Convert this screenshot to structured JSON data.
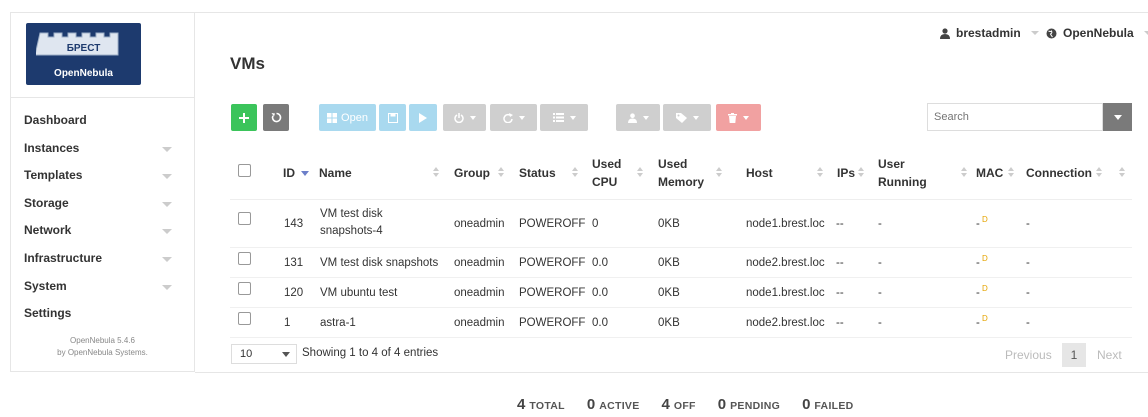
{
  "brand": {
    "logo_text": "БРЕСТ",
    "product": "OpenNebula",
    "colors": {
      "logo_bg": "#1d3a6e"
    }
  },
  "sidebar": {
    "items": [
      {
        "label": "Dashboard",
        "has_submenu": false
      },
      {
        "label": "Instances",
        "has_submenu": true
      },
      {
        "label": "Templates",
        "has_submenu": true
      },
      {
        "label": "Storage",
        "has_submenu": true
      },
      {
        "label": "Network",
        "has_submenu": true
      },
      {
        "label": "Infrastructure",
        "has_submenu": true
      },
      {
        "label": "System",
        "has_submenu": true
      },
      {
        "label": "Settings",
        "has_submenu": false
      }
    ],
    "version_line1": "OpenNebula 5.4.6",
    "version_line2": "by OpenNebula Systems."
  },
  "header": {
    "user": "brestadmin",
    "zone": "OpenNebula",
    "user_icon": "user-icon",
    "zone_icon": "globe-icon"
  },
  "page": {
    "title": "VMs"
  },
  "toolbar": {
    "create_icon": "plus-icon",
    "refresh_icon": "refresh-icon",
    "open_label": "Open",
    "search_placeholder": "Search",
    "colors": {
      "create": "#3bc45b",
      "refresh": "#7a7a7a",
      "search_button": "#7a7a7a"
    }
  },
  "table": {
    "columns": [
      "ID",
      "Name",
      "Group",
      "Status",
      "Used CPU",
      "Used Memory",
      "Host",
      "IPs",
      "User Running",
      "MAC",
      "Connection"
    ],
    "rows": [
      {
        "id": "143",
        "name": "VM test disk snapshots-4",
        "group": "oneadmin",
        "status": "POWEROFF",
        "cpu": "0",
        "memory": "0KB",
        "host": "node1.brest.loc",
        "ips": "--",
        "user_running": "-",
        "mac": "-",
        "mac_sup": "D",
        "connection": "-"
      },
      {
        "id": "131",
        "name": "VM test disk snapshots",
        "group": "oneadmin",
        "status": "POWEROFF",
        "cpu": "0.0",
        "memory": "0KB",
        "host": "node2.brest.loc",
        "ips": "--",
        "user_running": "-",
        "mac": "-",
        "mac_sup": "D",
        "connection": "-"
      },
      {
        "id": "120",
        "name": "VM ubuntu test",
        "group": "oneadmin",
        "status": "POWEROFF",
        "cpu": "0.0",
        "memory": "0KB",
        "host": "node1.brest.loc",
        "ips": "--",
        "user_running": "-",
        "mac": "-",
        "mac_sup": "D",
        "connection": "-"
      },
      {
        "id": "1",
        "name": "astra-1",
        "group": "oneadmin",
        "status": "POWEROFF",
        "cpu": "0.0",
        "memory": "0KB",
        "host": "node2.brest.loc",
        "ips": "--",
        "user_running": "-",
        "mac": "-",
        "mac_sup": "D",
        "connection": "-"
      }
    ]
  },
  "pagination": {
    "length": "10",
    "info": "Showing 1 to 4 of 4 entries",
    "previous": "Previous",
    "current": "1",
    "next": "Next"
  },
  "stats": [
    {
      "num": "4",
      "label": "TOTAL"
    },
    {
      "num": "0",
      "label": "ACTIVE"
    },
    {
      "num": "4",
      "label": "OFF"
    },
    {
      "num": "0",
      "label": "PENDING"
    },
    {
      "num": "0",
      "label": "FAILED"
    }
  ]
}
